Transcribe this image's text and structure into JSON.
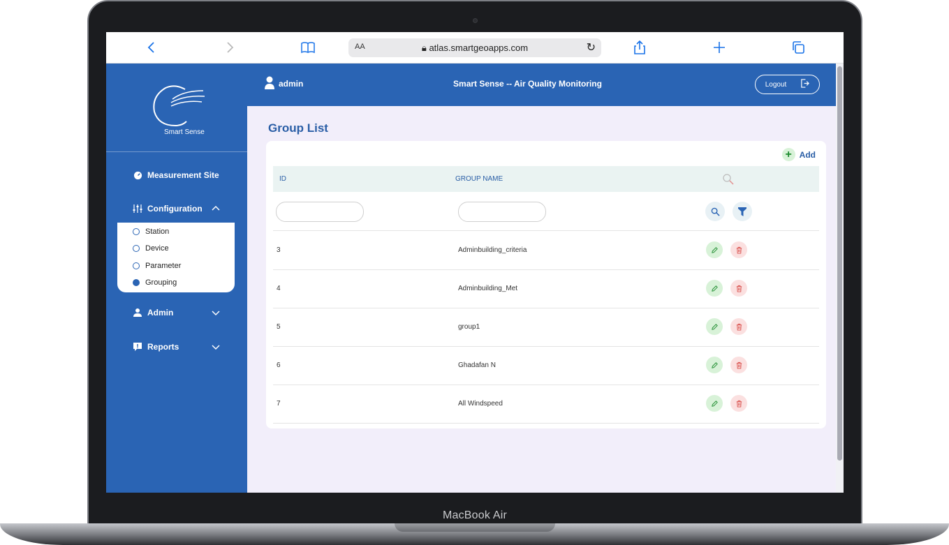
{
  "device": {
    "label": "MacBook Air"
  },
  "browser": {
    "aa_label": "AA",
    "url": "atlas.smartgeoapps.com"
  },
  "header": {
    "user": "admin",
    "title": "Smart Sense -- Air Quality Monitoring",
    "logout_label": "Logout"
  },
  "sidebar": {
    "logo_text": "Smart Sense",
    "items": [
      {
        "label": "Measurement Site",
        "icon": "gauge-icon"
      },
      {
        "label": "Configuration",
        "icon": "sliders-icon",
        "expanded": true
      },
      {
        "label": "Admin",
        "icon": "user-icon"
      },
      {
        "label": "Reports",
        "icon": "alert-icon"
      }
    ],
    "submenu": [
      {
        "label": "Station",
        "active": false
      },
      {
        "label": "Device",
        "active": false
      },
      {
        "label": "Parameter",
        "active": false
      },
      {
        "label": "Grouping",
        "active": true
      }
    ]
  },
  "main": {
    "title": "Group List",
    "add_label": "Add",
    "columns": [
      "ID",
      "GROUP NAME"
    ],
    "rows": [
      {
        "id": "3",
        "name": "Adminbuilding_criteria"
      },
      {
        "id": "4",
        "name": "Adminbuilding_Met"
      },
      {
        "id": "5",
        "name": "group1"
      },
      {
        "id": "6",
        "name": "Ghadafan N"
      },
      {
        "id": "7",
        "name": "All Windspeed"
      }
    ]
  },
  "colors": {
    "primary": "#2a64b4",
    "content_bg": "#f2eefa",
    "edit": "#d8f2d8",
    "delete": "#fbe0e0"
  }
}
